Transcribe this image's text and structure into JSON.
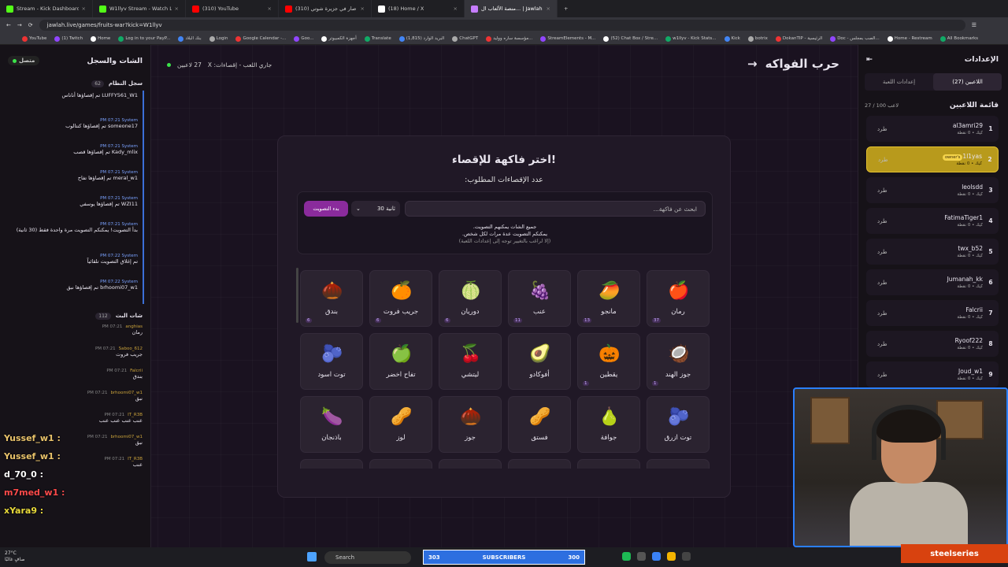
{
  "browser": {
    "tabs": [
      {
        "label": "Stream - Kick Dashboard",
        "color": "#53fc18"
      },
      {
        "label": "W1llyv Stream - Watch Live on",
        "color": "#53fc18"
      },
      {
        "label": "(310) YouTube",
        "color": "#ff0000"
      },
      {
        "label": "(310) وش صار في جزيرة شوتي",
        "color": "#ff0000"
      },
      {
        "label": "(18) Home / X",
        "color": "#ffffff"
      },
      {
        "label": "منصة الألعاب ال... | Jawlah | جولة",
        "color": "#c77dff",
        "active": true
      }
    ],
    "url": "jawlah.live/games/fruits-war?kick=W1llyv",
    "bookmarks": [
      "YouTube",
      "(1) Twitch",
      "Home",
      "Log in to your PayP...",
      "بنك البلاد",
      "Login",
      "Google Calendar -...",
      "Goo...",
      "أجهزة الكمبيوتر",
      "Translate",
      "(1,815) البريد الوارد",
      "ChatGPT",
      "مؤسسة ساره ووليد...",
      "StreamElements - M...",
      "(52) Chat Box / Stre...",
      "w1llyv - Kick Stats...",
      "Kick",
      "botrix",
      "DokanTIP - الرئيسية",
      "Doc - الصب بمجلس...",
      "Home - Restream",
      "All Bookmarks"
    ]
  },
  "left_panel": {
    "title": "الشات والسجل",
    "status": "متصل",
    "system_log": {
      "title": "سجل النظام",
      "count": "62",
      "messages": [
        {
          "meta": "",
          "text": "LUFFY561_W1 تم إقصاؤها أناناس"
        },
        {
          "meta": "PM 07:21  System",
          "text": "someone17 تم إقصاؤها كنتالوب"
        },
        {
          "meta": "PM 07:21  System",
          "text": "Kady_mlix تم إقصاؤها قصب"
        },
        {
          "meta": "PM 07:21  System",
          "text": "meral_w1 تم إقصاؤها تفاح"
        },
        {
          "meta": "PM 07:21  System",
          "text": "WZI11 تم إقصاؤها يوسفي"
        },
        {
          "meta": "PM 07:21  System",
          "text": "بدأ التصويت! يمكنكم التصويت مرة واحدة فقط (30 ثانية)"
        },
        {
          "meta": "PM 07:22  System",
          "text": "تم إغلاق التصويت تلقائياً"
        },
        {
          "meta": "PM 07:22  System",
          "text": "brhoomi07_w1 تم إقصاؤها نبق"
        }
      ]
    },
    "live_chat": {
      "title": "شات البث",
      "count": "112",
      "messages": [
        {
          "user": "anghias",
          "time": "PM 07:21",
          "text": "رمان"
        },
        {
          "user": "Saboo_612",
          "time": "PM 07:21",
          "text": "جريب فروت"
        },
        {
          "user": "Falcrii",
          "time": "PM 07:21",
          "text": "بندق"
        },
        {
          "user": "brhoomi07_w1",
          "time": "PM 07:21",
          "text": "نبق"
        },
        {
          "user": "IT_R3B",
          "time": "PM 07:21",
          "text": "عنب عنب عنب عنب"
        },
        {
          "user": "brhoomi07_w1",
          "time": "PM 07:21",
          "text": "نبق"
        },
        {
          "user": "IT_R3B",
          "time": "PM 07:21",
          "text": "عنب"
        }
      ]
    }
  },
  "overlay_chat": [
    {
      "user": "Yussef_w1 :",
      "color": "#e8c26a"
    },
    {
      "user": "Yussef_w1 :",
      "color": "#e8c26a"
    },
    {
      "user": "d_70_0 :",
      "color": "#ffffff"
    },
    {
      "user": "m7med_w1 :",
      "color": "#ff4a4a"
    },
    {
      "user": "xYara9 :",
      "color": "#e8d93a"
    }
  ],
  "header": {
    "game_title": "حرب الفواكه",
    "info": "جاري اللعب - إقصاءات: X",
    "players": "27 لاعبين"
  },
  "card": {
    "title": "اختر فاكهة للإقصاء!",
    "subtitle": "عدد الإقصاءات المطلوب:",
    "search_placeholder": "ابحث عن فاكهة...",
    "timer": "30 ثانية",
    "start_button": "بدء التصويت",
    "note1": "جميع الشات يمكنهم التصويت.",
    "note2": "يمكنكم التصويت عدة مرات لكل شخص.",
    "note3": "(إلا لراغب بالتغيير توجه إلى إعدادات اللعبة)"
  },
  "fruits": [
    {
      "name": "رمان",
      "icon": "🍎",
      "votes": "37"
    },
    {
      "name": "مانجو",
      "icon": "🥭",
      "votes": "13"
    },
    {
      "name": "عنب",
      "icon": "🍇",
      "votes": "11"
    },
    {
      "name": "دوريان",
      "icon": "🍈",
      "votes": "6"
    },
    {
      "name": "جريب فروت",
      "icon": "🍊",
      "votes": "6"
    },
    {
      "name": "بندق",
      "icon": "🌰",
      "votes": "6"
    },
    {
      "name": "جوز الهند",
      "icon": "🥥",
      "votes": "1"
    },
    {
      "name": "يقطين",
      "icon": "🎃",
      "votes": "1"
    },
    {
      "name": "أفوكادو",
      "icon": "🥑",
      "votes": ""
    },
    {
      "name": "ليتشي",
      "icon": "🍒",
      "votes": ""
    },
    {
      "name": "تفاح اخضر",
      "icon": "🍏",
      "votes": ""
    },
    {
      "name": "توت اسود",
      "icon": "🫐",
      "votes": ""
    },
    {
      "name": "توت ازرق",
      "icon": "🫐",
      "votes": ""
    },
    {
      "name": "جوافة",
      "icon": "🍐",
      "votes": ""
    },
    {
      "name": "فستق",
      "icon": "🥜",
      "votes": ""
    },
    {
      "name": "جوز",
      "icon": "🌰",
      "votes": ""
    },
    {
      "name": "لوز",
      "icon": "🥜",
      "votes": ""
    },
    {
      "name": "باذنجان",
      "icon": "🍆",
      "votes": ""
    }
  ],
  "right_panel": {
    "title": "الإعدادات",
    "tab_players": "اللاعبين (27)",
    "tab_settings": "إعدادات اللعبة",
    "list_title": "قائمة اللاعبين",
    "list_count": "27 / 100 لاعب",
    "kick_label": "طرد",
    "owner_badge": "owner's",
    "players": [
      {
        "num": "1",
        "name": "al3amri29",
        "stat": "كيك • 0 نقطة"
      },
      {
        "num": "2",
        "name": "1l1yas",
        "stat": "كيك • 0 نقطة",
        "highlight": true
      },
      {
        "num": "3",
        "name": "leolsdd",
        "stat": "كيك • 0 نقطة"
      },
      {
        "num": "4",
        "name": "FatimaTiger1",
        "stat": "كيك • 0 نقطة"
      },
      {
        "num": "5",
        "name": "twx_b52",
        "stat": "كيك • 0 نقطة"
      },
      {
        "num": "6",
        "name": "Jumanah_kk",
        "stat": "كيك • 0 نقطة"
      },
      {
        "num": "7",
        "name": "Falcrii",
        "stat": "كيك • 0 نقطة"
      },
      {
        "num": "8",
        "name": "Ryoof222",
        "stat": "كيك • 0 نقطة"
      },
      {
        "num": "9",
        "name": "Joud_w1",
        "stat": "كيك • 0 نقطة"
      }
    ]
  },
  "overlay": {
    "subs_left": "303",
    "subs_label": "SUBSCRIBERS",
    "subs_right": "300",
    "brand": "steelseries"
  },
  "taskbar": {
    "search": "Search",
    "weather_temp": "27°C",
    "weather_text": "صافٍ غالبًا"
  }
}
